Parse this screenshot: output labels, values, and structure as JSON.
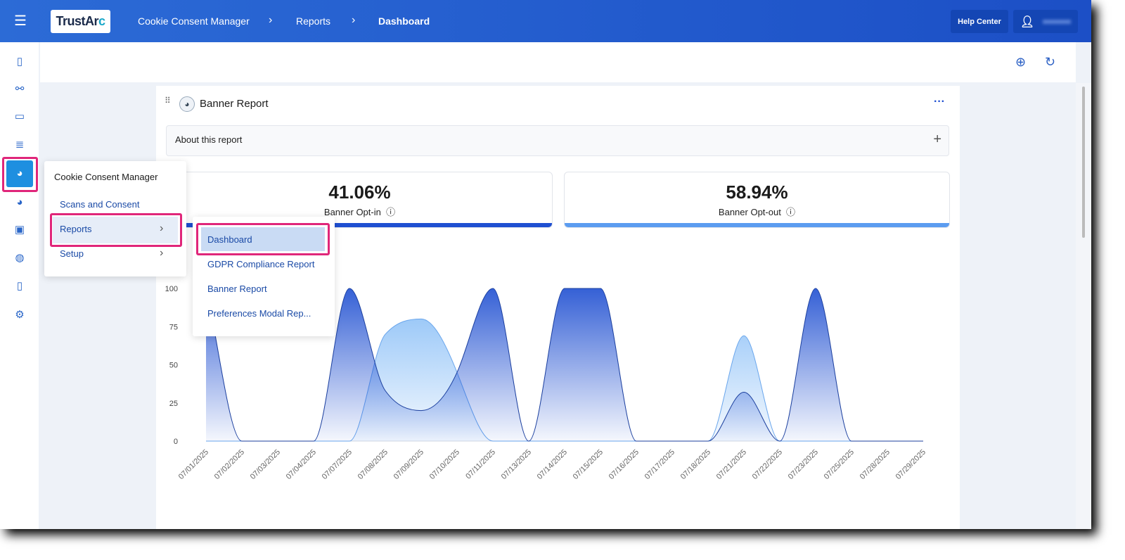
{
  "header": {
    "logo": "TrustArc",
    "breadcrumb": [
      "Cookie Consent Manager",
      "Reports",
      "Dashboard"
    ],
    "help_center": "Help Center"
  },
  "sidebar": {
    "icons": [
      "report-icon",
      "network-icon",
      "monitor-icon",
      "users-list-icon",
      "cookie-consent-icon",
      "cookie-icon",
      "id-card-icon",
      "globe-icon",
      "document-clock-icon",
      "settings-icon"
    ],
    "active": "cookie-consent-icon"
  },
  "toolbar": {
    "icons": [
      "add-icon",
      "refresh-icon"
    ]
  },
  "card": {
    "title": "Banner Report",
    "about": "About this report",
    "stats": [
      {
        "value": "41.06%",
        "label": "Banner Opt-in",
        "color": "#1f4fd1"
      },
      {
        "value": "58.94%",
        "label": "Banner Opt-out",
        "color": "#5b9cf0"
      }
    ]
  },
  "flyout": {
    "title": "Cookie Consent Manager",
    "items": [
      "Scans and Consent",
      "Reports",
      "Setup"
    ],
    "submenu": [
      "Dashboard",
      "GDPR Compliance Report",
      "Banner Report",
      "Preferences Modal Rep..."
    ],
    "selected": "Dashboard"
  },
  "chart_data": {
    "type": "area",
    "categories": [
      "07/01/2025",
      "07/02/2025",
      "07/03/2025",
      "07/04/2025",
      "07/07/2025",
      "07/08/2025",
      "07/09/2025",
      "07/10/2025",
      "07/11/2025",
      "07/13/2025",
      "07/14/2025",
      "07/15/2025",
      "07/16/2025",
      "07/17/2025",
      "07/18/2025",
      "07/21/2025",
      "07/22/2025",
      "07/23/2025",
      "07/25/2025",
      "07/28/2025",
      "07/29/2025"
    ],
    "series": [
      {
        "values": [
          100,
          0,
          0,
          0,
          100,
          33,
          20,
          45,
          100,
          0,
          100,
          100,
          0,
          0,
          0,
          32,
          0,
          100,
          0,
          0,
          0
        ],
        "color": "#1f4fd1"
      },
      {
        "values": [
          0,
          0,
          0,
          0,
          0,
          70,
          80,
          45,
          0,
          0,
          0,
          0,
          0,
          0,
          0,
          69,
          0,
          0,
          0,
          0,
          0
        ],
        "color": "#8cc0f7"
      }
    ],
    "yticks": [
      0,
      25,
      50,
      75,
      100
    ],
    "ylim": [
      0,
      100
    ],
    "grid": false
  }
}
